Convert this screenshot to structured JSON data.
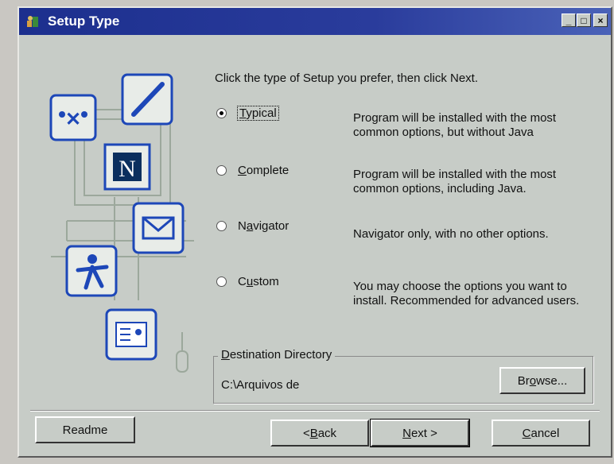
{
  "window": {
    "title": "Setup Type",
    "controls": {
      "minimize": "_",
      "maximize": "□",
      "close": "×"
    }
  },
  "instructions": "Click the type of Setup you prefer, then click Next.",
  "options": [
    {
      "label_pre": "",
      "label_u": "T",
      "label_post": "ypical",
      "description": "Program will be installed with the most common options, but without Java",
      "selected": true
    },
    {
      "label_pre": "",
      "label_u": "C",
      "label_post": "omplete",
      "description": "Program will be installed with the most common options, including Java.",
      "selected": false
    },
    {
      "label_pre": "N",
      "label_u": "a",
      "label_post": "vigator",
      "description": "Navigator only, with no other options.",
      "selected": false
    },
    {
      "label_pre": "C",
      "label_u": "u",
      "label_post": "stom",
      "description": "You may choose the options you want to install.  Recommended for advanced users.",
      "selected": false
    }
  ],
  "destination": {
    "label_u": "D",
    "label_post": "estination Directory",
    "path": "C:\\Arquivos de",
    "browse_pre": "Br",
    "browse_u": "o",
    "browse_post": "wse..."
  },
  "buttons": {
    "readme": "Readme",
    "back_pre": "< ",
    "back_u": "B",
    "back_post": "ack",
    "next_u": "N",
    "next_post": "ext >",
    "cancel_u": "C",
    "cancel_post": "ancel"
  },
  "colors": {
    "titlebar": "#1c2f8e",
    "icon_border": "#1d47b8",
    "dialog_bg": "#c7ccc7"
  }
}
